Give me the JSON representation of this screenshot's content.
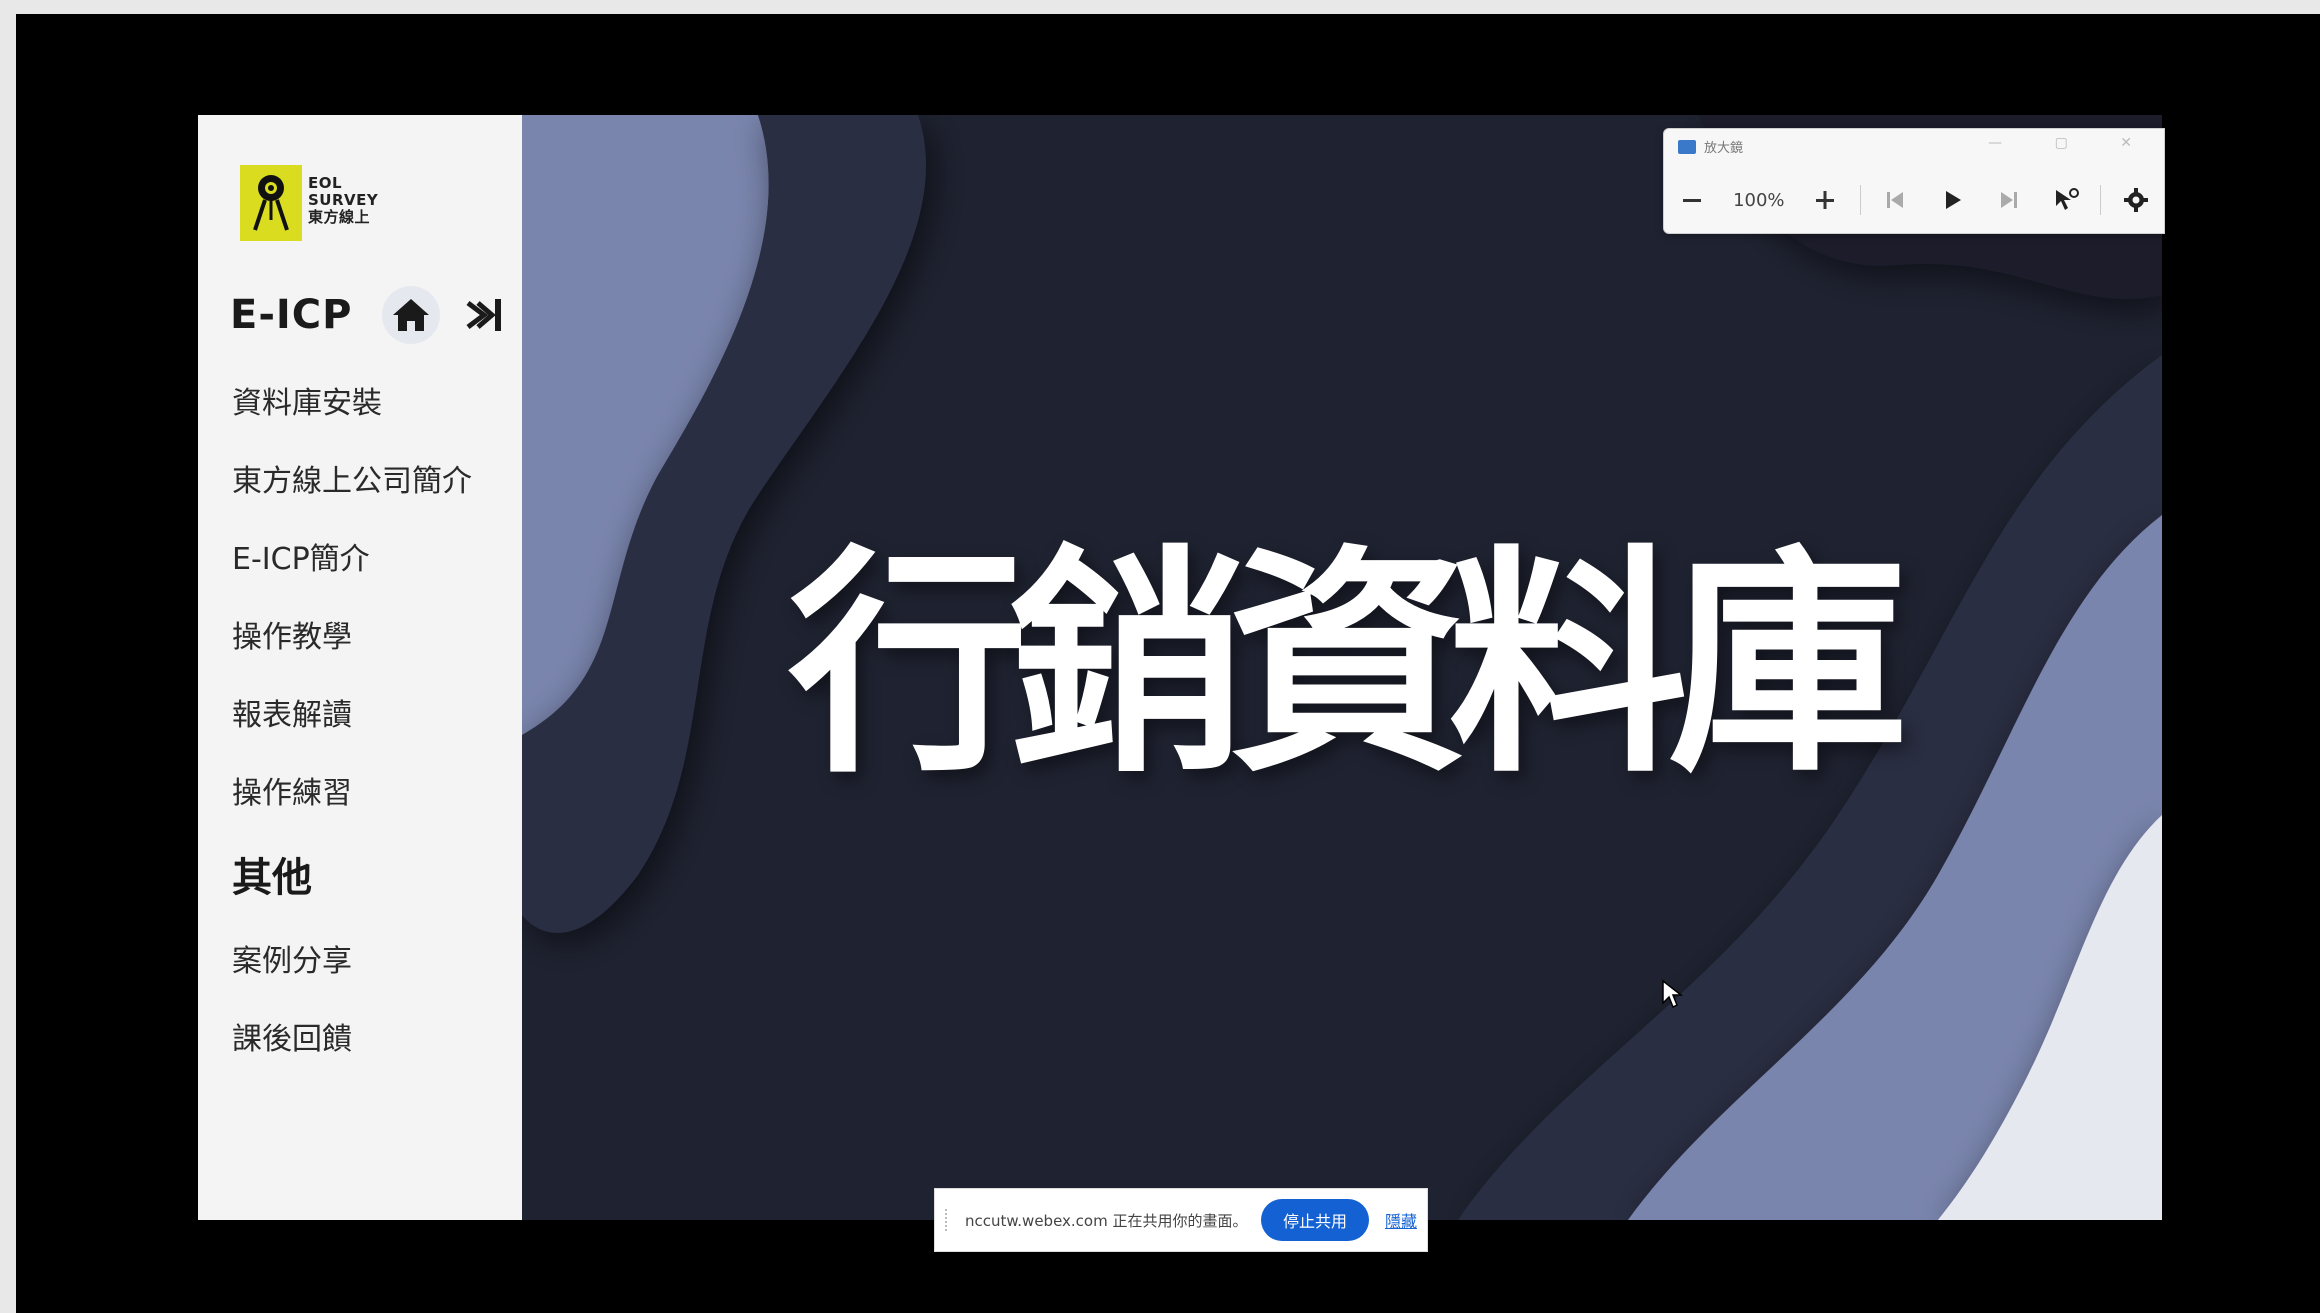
{
  "sidebar": {
    "logo_lines": [
      "EOL",
      "SURVEY",
      "東方線上"
    ],
    "brand": "E-ICP",
    "home_icon": "home-icon",
    "collapse_icon": "sidebar-collapse-icon",
    "items": [
      {
        "label": "資料庫安裝"
      },
      {
        "label": "東方線上公司簡介"
      },
      {
        "label": "E-ICP簡介"
      },
      {
        "label": "操作教學"
      },
      {
        "label": "報表解讀"
      },
      {
        "label": "操作練習"
      }
    ],
    "section_heading": "其他",
    "items_other": [
      {
        "label": "案例分享"
      },
      {
        "label": "課後回饋"
      }
    ]
  },
  "slide": {
    "title": "行銷資料庫"
  },
  "magnifier": {
    "title": "放大鏡",
    "zoom": "100%",
    "tools": [
      "minus-icon",
      "plus-icon",
      "skip-back-icon",
      "play-icon",
      "skip-forward-icon",
      "cursor-icon",
      "gear-icon"
    ]
  },
  "share_bar": {
    "text": "nccutw.webex.com 正在共用你的畫面。",
    "stop_label": "停止共用",
    "hide_label": "隱藏"
  },
  "colors": {
    "slide_bg": "#1f2331",
    "wave_light": "#7a85ad",
    "wave_pale": "#e6e8f0",
    "logo_yellow": "#d9dc1f",
    "accent_blue": "#1461d4"
  }
}
